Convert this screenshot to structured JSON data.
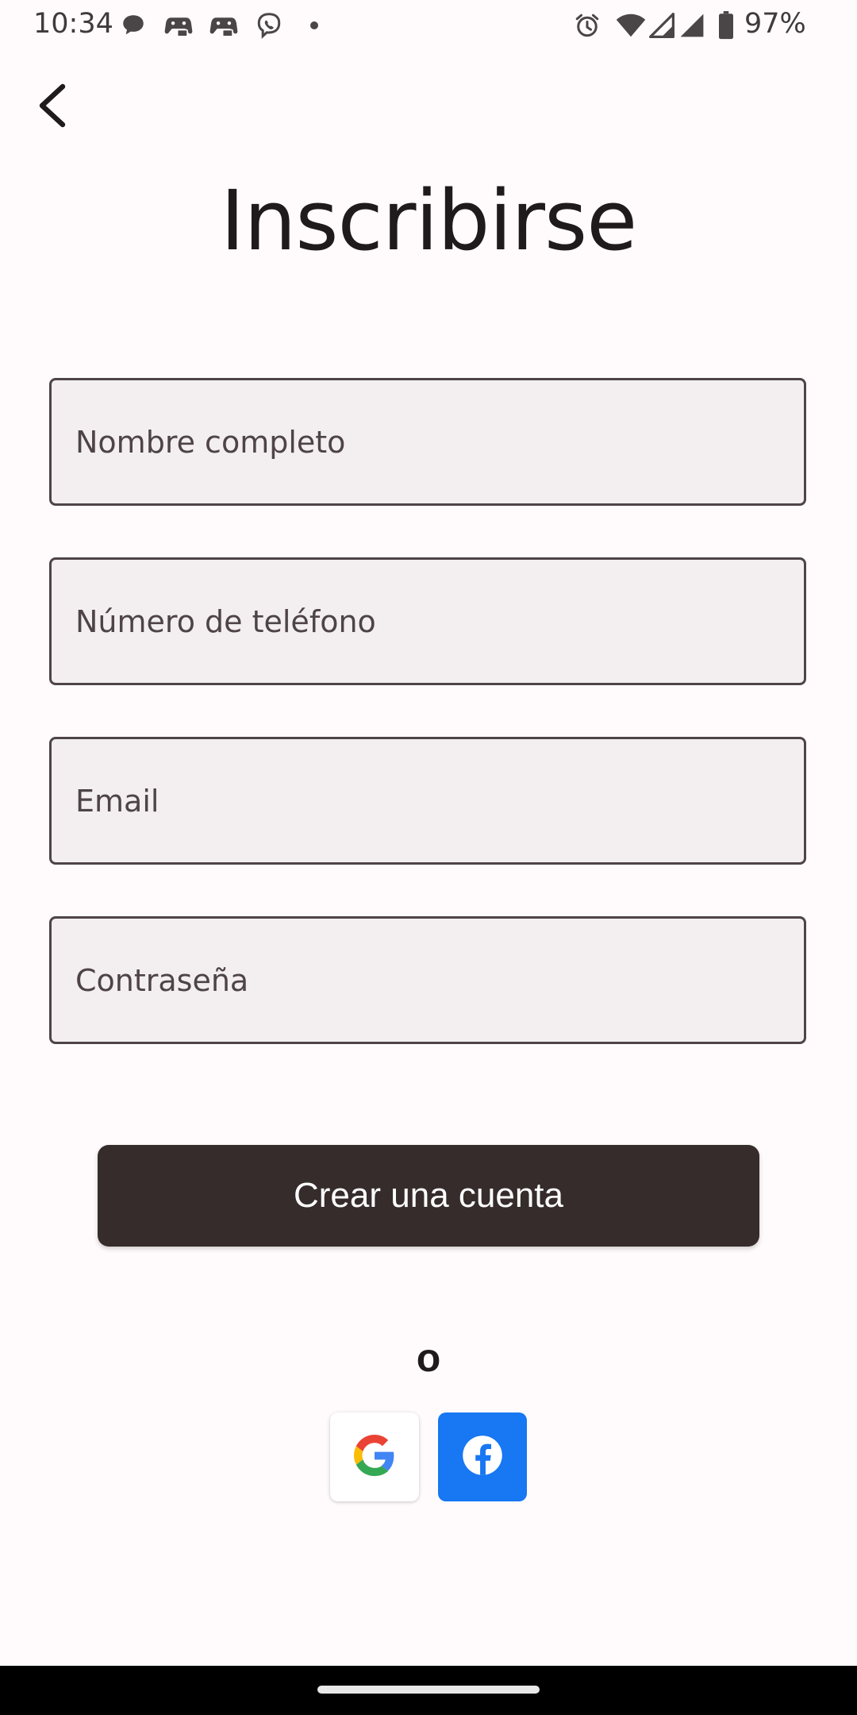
{
  "status_bar": {
    "time": "10:34",
    "notification_icons": [
      "chat-bubble-icon",
      "game-controller-icon",
      "game-controller-icon",
      "viber-icon",
      "dot-icon"
    ],
    "system_icons": [
      "alarm-icon",
      "wifi-icon",
      "cell-signal-icon",
      "cell-signal-icon",
      "battery-icon"
    ],
    "battery_percent": "97%"
  },
  "header": {
    "back_icon": "chevron-left-icon",
    "title": "Inscribirse"
  },
  "form": {
    "fields": [
      {
        "name": "full-name-field",
        "placeholder": "Nombre completo",
        "value": ""
      },
      {
        "name": "phone-field",
        "placeholder": "Número de teléfono",
        "value": ""
      },
      {
        "name": "email-field",
        "placeholder": "Email",
        "value": ""
      },
      {
        "name": "password-field",
        "placeholder": "Contraseña",
        "value": ""
      }
    ],
    "submit_label": "Crear una cuenta"
  },
  "social": {
    "separator": "o",
    "providers": [
      {
        "name": "google",
        "icon": "google-icon"
      },
      {
        "name": "facebook",
        "icon": "facebook-icon"
      }
    ]
  },
  "colors": {
    "background": "#fffbfc",
    "field_background": "#f3eff0",
    "field_border": "#4e4447",
    "primary_button": "#362c2c",
    "facebook_blue": "#1877f2"
  }
}
